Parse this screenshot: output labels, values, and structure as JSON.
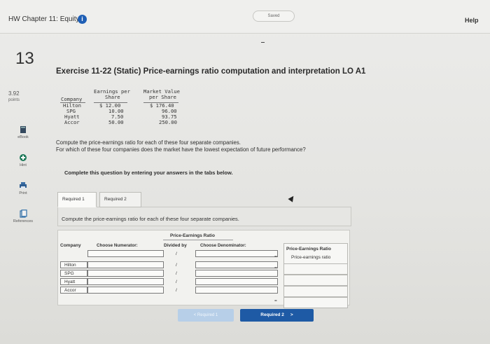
{
  "header": {
    "title": "HW Chapter 11: Equity",
    "info_icon": "i",
    "saved": "Saved",
    "help": "Help"
  },
  "question": {
    "number": "13",
    "points_value": "3.92",
    "points_label": "points",
    "title": "Exercise 11-22 (Static) Price-earnings ratio computation and interpretation LO A1"
  },
  "sidebar": {
    "items": [
      {
        "label": "eBook",
        "icon": "book-icon"
      },
      {
        "label": "Hint",
        "icon": "hint-icon"
      },
      {
        "label": "Print",
        "icon": "print-icon"
      },
      {
        "label": "References",
        "icon": "references-icon"
      }
    ]
  },
  "data_table": {
    "headers": {
      "company": "Company",
      "eps_line1": "Earnings per",
      "eps_line2": "Share",
      "mv_line1": "Market Value",
      "mv_line2": "per Share"
    },
    "rows": [
      {
        "company": "Hilton",
        "eps": "$ 12.00",
        "mv": "$ 176.40"
      },
      {
        "company": "SPG",
        "eps": "10.00",
        "mv": "96.00"
      },
      {
        "company": "Hyatt",
        "eps": "7.50",
        "mv": "93.75"
      },
      {
        "company": "Accor",
        "eps": "50.00",
        "mv": "250.00"
      }
    ]
  },
  "prompt": {
    "line1": "Compute the price-earnings ratio for each of these four separate companies.",
    "line2": "For which of these four companies does the market have the lowest expectation of future performance?"
  },
  "instructions": "Complete this question by entering your answers in the tabs below.",
  "tabs": [
    {
      "label": "Required 1",
      "active": true
    },
    {
      "label": "Required 2",
      "active": false
    }
  ],
  "tab_prompt": "Compute the price-earnings ratio for each of these four separate companies.",
  "answer_table": {
    "group_header": "Price-Earnings Ratio",
    "col_company": "Company",
    "col_numerator": "Choose Numerator:",
    "col_divided": "Divided by",
    "col_denominator": "Choose Denominator:",
    "col_result_line1": "Price-Earnings Ratio",
    "col_result_line2": "Price-earnings ratio",
    "divide_symbol": "/",
    "equals_symbol": "=",
    "rows": [
      "Hilton",
      "SPG",
      "Hyatt",
      "Accor"
    ]
  },
  "nav": {
    "prev": "Required 1",
    "next": "Required 2",
    "next_chevron": ">",
    "prev_chevron": "<"
  }
}
